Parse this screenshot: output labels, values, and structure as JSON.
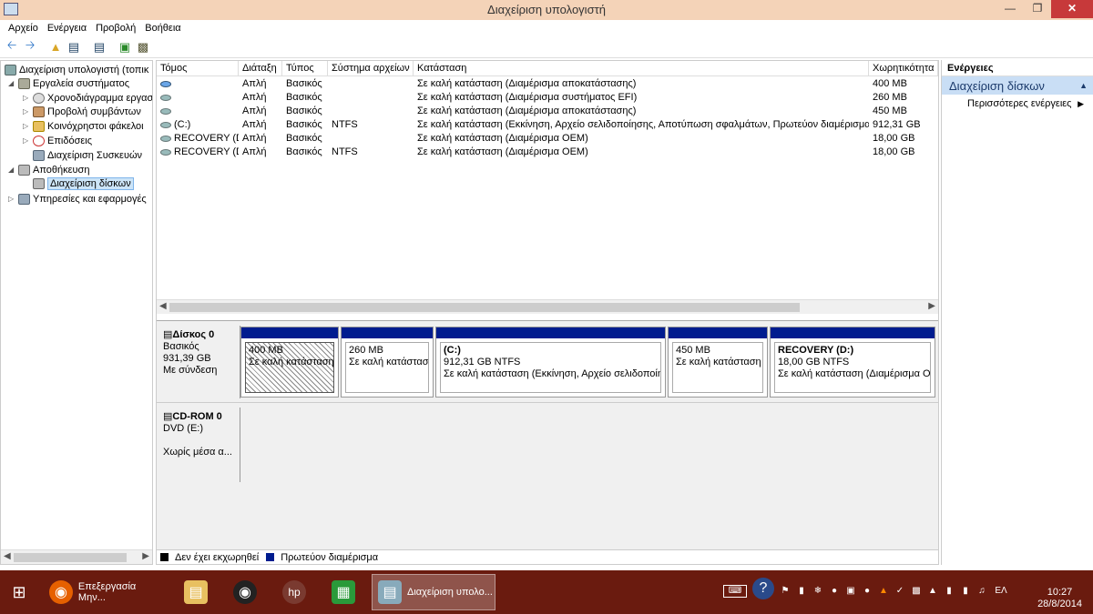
{
  "window": {
    "title": "Διαχείριση υπολογιστή"
  },
  "menu": [
    "Αρχείο",
    "Ενέργεια",
    "Προβολή",
    "Βοήθεια"
  ],
  "tree": {
    "root": "Διαχείριση υπολογιστή (τοπικ",
    "system_tools": "Εργαλεία συστήματος",
    "task_scheduler": "Χρονοδιάγραμμα εργασ",
    "event_viewer": "Προβολή συμβάντων",
    "shared_folders": "Κοινόχρηστοι φάκελοι",
    "performance": "Επιδόσεις",
    "device_manager": "Διαχείριση Συσκευών",
    "storage": "Αποθήκευση",
    "disk_management": "Διαχείριση δίσκων",
    "services": "Υπηρεσίες και εφαρμογές"
  },
  "volumes": {
    "headers": [
      "Τόμος",
      "Διάταξη",
      "Τύπος",
      "Σύστημα αρχείων",
      "Κατάσταση",
      "Χωρητικότητα"
    ],
    "rows": [
      {
        "volume": "",
        "layout": "Απλή",
        "type": "Βασικός",
        "fs": "",
        "status": "Σε καλή κατάσταση (Διαμέρισμα αποκατάστασης)",
        "capacity": "400 MB"
      },
      {
        "volume": "",
        "layout": "Απλή",
        "type": "Βασικός",
        "fs": "",
        "status": "Σε καλή κατάσταση (Διαμέρισμα συστήματος EFI)",
        "capacity": "260 MB"
      },
      {
        "volume": "",
        "layout": "Απλή",
        "type": "Βασικός",
        "fs": "",
        "status": "Σε καλή κατάσταση (Διαμέρισμα αποκατάστασης)",
        "capacity": "450 MB"
      },
      {
        "volume": "(C:)",
        "layout": "Απλή",
        "type": "Βασικός",
        "fs": "NTFS",
        "status": "Σε καλή κατάσταση (Εκκίνηση, Αρχείο σελιδοποίησης, Αποτύπωση σφαλμάτων, Πρωτεύον διαμέρισμα)",
        "capacity": "912,31 GB"
      },
      {
        "volume": "RECOVERY (D:)",
        "layout": "Απλή",
        "type": "Βασικός",
        "fs": "",
        "status": "Σε καλή κατάσταση (Διαμέρισμα OEM)",
        "capacity": "18,00 GB"
      },
      {
        "volume": "RECOVERY (D:)",
        "layout": "Απλή",
        "type": "Βασικός",
        "fs": "NTFS",
        "status": "Σε καλή κατάσταση (Διαμέρισμα OEM)",
        "capacity": "18,00 GB"
      }
    ]
  },
  "disk0": {
    "name": "Δίσκος 0",
    "type": "Βασικός",
    "size": "931,39 GB",
    "state": "Με σύνδεση",
    "partitions": [
      {
        "line1": "",
        "line2": "400 MB",
        "line3": "Σε καλή κατάσταση (Διαμέρισμα αποκατάστασης)"
      },
      {
        "line1": "",
        "line2": "260 MB",
        "line3": "Σε καλή κατάσταση (Διαμέρισμα συστήματος EFI)"
      },
      {
        "line1": "(C:)",
        "line2": "912,31 GB NTFS",
        "line3": "Σε καλή κατάσταση (Εκκίνηση, Αρχείο σελιδοποίησης"
      },
      {
        "line1": "",
        "line2": "450 MB",
        "line3": "Σε καλή κατάσταση (Διαμέρισμα αποκατάστασης)"
      },
      {
        "line1": "RECOVERY  (D:)",
        "line2": "18,00 GB NTFS",
        "line3": "Σε καλή κατάσταση (Διαμέρισμα OEM)"
      }
    ]
  },
  "cdrom0": {
    "name": "CD-ROM 0",
    "drive": "DVD (E:)",
    "media": "Χωρίς μέσα α..."
  },
  "legend": {
    "unallocated": "Δεν έχει εκχωρηθεί",
    "primary": "Πρωτεύον διαμέρισμα"
  },
  "actions": {
    "header": "Ενέργειες",
    "section": "Διαχείριση δίσκων",
    "more": "Περισσότερες ενέργειες"
  },
  "taskbar": {
    "firefox": "Επεξεργασία Μην...",
    "mmc": "Διαχείριση υπολο..."
  },
  "clock": {
    "time": "10:27",
    "date": "28/8/2014",
    "lang": "ΕΛ"
  },
  "colors": {
    "primary_partition": "#001c8f",
    "taskbar": "#6a1b0f",
    "titlebar": "#f4d3b8"
  }
}
